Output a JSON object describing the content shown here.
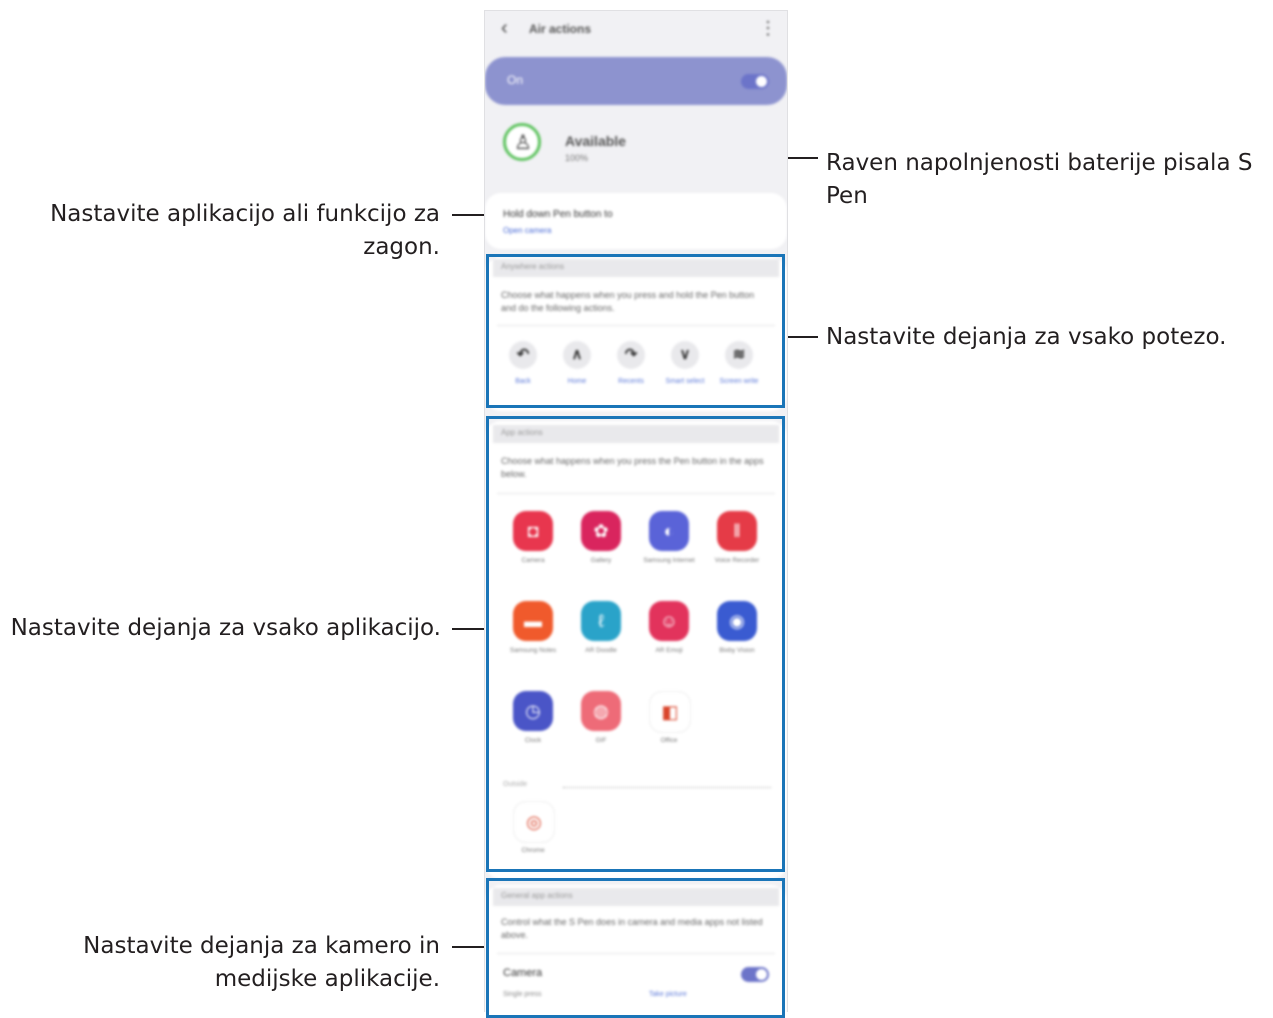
{
  "callouts": {
    "battery": "Raven napolnjenosti baterije pisala S Pen",
    "app_launch": "Nastavite aplikacijo ali funkcijo za zagon.",
    "gestures": "Nastavite dejanja za vsako potezo.",
    "apps": "Nastavite dejanja za vsako aplikacijo.",
    "camera_media": "Nastavite dejanja za kamero in medijske aplikacije."
  },
  "phone": {
    "title": "Air actions",
    "on_label": "On",
    "status": "Available",
    "battery_level": "100%",
    "hold_title": "Hold down Pen button to",
    "hold_value": "Open camera",
    "anywhere": {
      "header": "Anywhere actions",
      "description": "Choose what happens when you press and hold the Pen button and do the following actions.",
      "gestures": [
        {
          "symbol": "↶",
          "label": "Back"
        },
        {
          "symbol": "∧",
          "label": "Home"
        },
        {
          "symbol": "↷",
          "label": "Recents"
        },
        {
          "symbol": "∨",
          "label": "Smart select"
        },
        {
          "symbol": "≋",
          "label": "Screen write"
        }
      ]
    },
    "app_actions": {
      "header": "App actions",
      "description": "Choose what happens when you press the Pen button in the apps below.",
      "apps": [
        {
          "label": "Camera",
          "color": "#e8364e",
          "glyph": "◘"
        },
        {
          "label": "Gallery",
          "color": "#d9255e",
          "glyph": "✿"
        },
        {
          "label": "Samsung Internet",
          "color": "#5a63d8",
          "glyph": "◐"
        },
        {
          "label": "Voice Recorder",
          "color": "#e53b47",
          "glyph": "‖"
        },
        {
          "label": "Samsung Notes",
          "color": "#f05a2c",
          "glyph": "▬"
        },
        {
          "label": "AR Doodle",
          "color": "#2aa3c9",
          "glyph": "ℓ"
        },
        {
          "label": "AR Emoji",
          "color": "#e2335c",
          "glyph": "☺"
        },
        {
          "label": "Bixby Vision",
          "color": "#3a5bd1",
          "glyph": "◉"
        },
        {
          "label": "Clock",
          "color": "#4a55c7",
          "glyph": "◷"
        },
        {
          "label": "GIF",
          "color": "#ee6b78",
          "glyph": "◍"
        },
        {
          "label": "Office",
          "color": "#ffffff",
          "glyph": "◧"
        }
      ],
      "section_label": "Outside",
      "extra_apps": [
        {
          "label": "Chrome",
          "color": "#ffffff",
          "glyph": "◎"
        }
      ]
    },
    "general": {
      "header": "General app actions",
      "description": "Control what the S Pen does in camera and media apps not listed above.",
      "camera_label": "Camera",
      "single_press": "Single press",
      "single_value": "Take picture"
    }
  }
}
